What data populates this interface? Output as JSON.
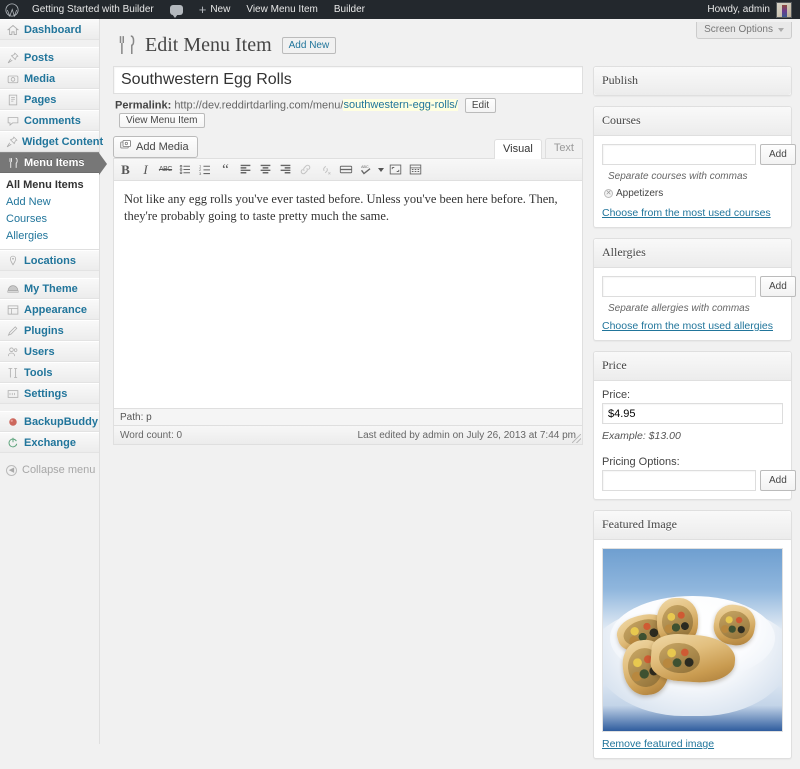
{
  "adminbar": {
    "logo_icon": "wordpress-logo-icon",
    "site_name": "Getting Started with Builder",
    "comments_icon": "comment-bubble-icon",
    "new_label": "New",
    "new_icon": "plus-icon",
    "view_item_label": "View Menu Item",
    "builder_label": "Builder",
    "howdy_label": "Howdy, admin",
    "avatar_icon": "user-avatar"
  },
  "screen_meta": {
    "screen_options_label": "Screen Options",
    "caret_icon": "chevron-down-icon"
  },
  "sidebar": {
    "items": [
      {
        "label": "Dashboard",
        "icon": "dashboard-home-icon",
        "current": false
      },
      {
        "label": "Posts",
        "icon": "pin-icon",
        "current": false
      },
      {
        "label": "Media",
        "icon": "media-camera-icon",
        "current": false
      },
      {
        "label": "Pages",
        "icon": "page-document-icon",
        "current": false
      },
      {
        "label": "Comments",
        "icon": "comment-bubble-icon",
        "current": false
      },
      {
        "label": "Widget Content",
        "icon": "pin-icon",
        "current": false
      },
      {
        "label": "Menu Items",
        "icon": "fork-knife-icon",
        "current": true
      },
      {
        "label": "Locations",
        "icon": "map-pin-icon",
        "current": false
      },
      {
        "label": "My Theme",
        "icon": "theme-icon",
        "current": false
      },
      {
        "label": "Appearance",
        "icon": "appearance-brush-icon",
        "current": false
      },
      {
        "label": "Plugins",
        "icon": "plug-icon",
        "current": false
      },
      {
        "label": "Users",
        "icon": "users-icon",
        "current": false
      },
      {
        "label": "Tools",
        "icon": "tools-hammer-icon",
        "current": false
      },
      {
        "label": "Settings",
        "icon": "settings-gear-icon",
        "current": false
      },
      {
        "label": "BackupBuddy",
        "icon": "backupbuddy-icon",
        "current": false
      },
      {
        "label": "Exchange",
        "icon": "exchange-icon",
        "current": false
      }
    ],
    "submenu": [
      {
        "label": "All Menu Items",
        "current": true
      },
      {
        "label": "Add New",
        "current": false
      },
      {
        "label": "Courses",
        "current": false
      },
      {
        "label": "Allergies",
        "current": false
      }
    ],
    "collapse_label": "Collapse menu",
    "collapse_icon": "collapse-arrow-icon"
  },
  "page": {
    "icon": "fork-knife-icon",
    "title": "Edit Menu Item",
    "add_new_label": "Add New"
  },
  "title_field": {
    "value": "Southwestern Egg Rolls",
    "placeholder": "Enter title here"
  },
  "permalink": {
    "label": "Permalink:",
    "base_url": "http://dev.reddirtdarling.com/menu/",
    "slug": "southwestern-egg-rolls/",
    "edit_label": "Edit",
    "view_label": "View Menu Item"
  },
  "editor": {
    "add_media_label": "Add Media",
    "add_media_icon": "media-add-icon",
    "tabs": [
      {
        "label": "Visual",
        "active": true
      },
      {
        "label": "Text",
        "active": false
      }
    ],
    "toolbar": [
      {
        "icon": "bold-icon",
        "glyph": "B",
        "dim": false
      },
      {
        "icon": "italic-icon",
        "glyph": "I",
        "dim": false
      },
      {
        "icon": "strikethrough-icon",
        "glyph": "ABC",
        "dim": false
      },
      {
        "icon": "unordered-list-icon",
        "glyph": "",
        "dim": false
      },
      {
        "icon": "ordered-list-icon",
        "glyph": "",
        "dim": false
      },
      {
        "icon": "blockquote-icon",
        "glyph": "“",
        "dim": false
      },
      {
        "icon": "align-left-icon",
        "glyph": "",
        "dim": false
      },
      {
        "icon": "align-center-icon",
        "glyph": "",
        "dim": false
      },
      {
        "icon": "align-right-icon",
        "glyph": "",
        "dim": false
      },
      {
        "icon": "insert-link-icon",
        "glyph": "",
        "dim": true
      },
      {
        "icon": "unlink-icon",
        "glyph": "",
        "dim": true
      },
      {
        "icon": "insert-more-tag-icon",
        "glyph": "",
        "dim": false
      },
      {
        "icon": "spellcheck-icon",
        "glyph": "ABC",
        "dim": false
      },
      {
        "icon": "fullscreen-icon",
        "glyph": "",
        "dim": false
      },
      {
        "icon": "kitchen-sink-icon",
        "glyph": "",
        "dim": false
      }
    ],
    "content": "Not like any egg rolls you've ever tasted before. Unless you've been here before. Then, they're probably going to taste pretty much the same.",
    "path_label": "Path: p",
    "word_count_label": "Word count: 0",
    "last_edited_label": "Last edited by admin on July 26, 2013 at 7:44 pm"
  },
  "metaboxes": {
    "publish": {
      "title": "Publish"
    },
    "courses": {
      "title": "Courses",
      "input_value": "",
      "add_label": "Add",
      "hint": "Separate courses with commas",
      "tags": [
        {
          "label": "Appetizers",
          "remove_icon": "remove-tag-icon"
        }
      ],
      "cloud_link": "Choose from the most used courses"
    },
    "allergies": {
      "title": "Allergies",
      "input_value": "",
      "add_label": "Add",
      "hint": "Separate allergies with commas",
      "cloud_link": "Choose from the most used allergies"
    },
    "price": {
      "title": "Price",
      "price_label": "Price:",
      "price_value": "$4.95",
      "example_hint": "Example: $13.00",
      "pricing_options_label": "Pricing Options:",
      "pricing_options_value": "",
      "add_label": "Add"
    },
    "featured_image": {
      "title": "Featured Image",
      "image_alt": "Plated southwestern egg rolls on a white dish",
      "remove_label": "Remove featured image"
    }
  },
  "colors": {
    "adminbar_bg": "#23282d",
    "link": "#21759b",
    "current_menu_bg": "#777777",
    "slug_highlight": "#ffffe0",
    "body_bg": "#f1f1f1"
  }
}
